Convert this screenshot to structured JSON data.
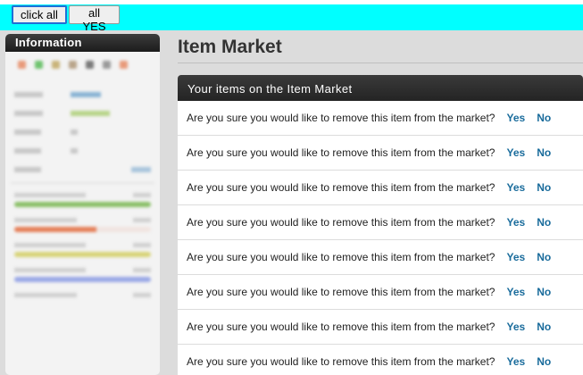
{
  "toolbar": {
    "click_all_label": "click all",
    "all_yes_label": "all YES",
    "background_color": "#00ffff"
  },
  "sidebar": {
    "header": "Information"
  },
  "main": {
    "title": "Item Market",
    "panel_title": "Your items on the Item Market",
    "rows": [
      {
        "question": "Are you sure you would like to remove this item from the market?",
        "yes": "Yes",
        "no": "No"
      },
      {
        "question": "Are you sure you would like to remove this item from the market?",
        "yes": "Yes",
        "no": "No"
      },
      {
        "question": "Are you sure you would like to remove this item from the market?",
        "yes": "Yes",
        "no": "No"
      },
      {
        "question": "Are you sure you would like to remove this item from the market?",
        "yes": "Yes",
        "no": "No"
      },
      {
        "question": "Are you sure you would like to remove this item from the market?",
        "yes": "Yes",
        "no": "No"
      },
      {
        "question": "Are you sure you would like to remove this item from the market?",
        "yes": "Yes",
        "no": "No"
      },
      {
        "question": "Are you sure you would like to remove this item from the market?",
        "yes": "Yes",
        "no": "No"
      },
      {
        "question": "Are you sure you would like to remove this item from the market?",
        "yes": "Yes",
        "no": "No"
      }
    ]
  }
}
